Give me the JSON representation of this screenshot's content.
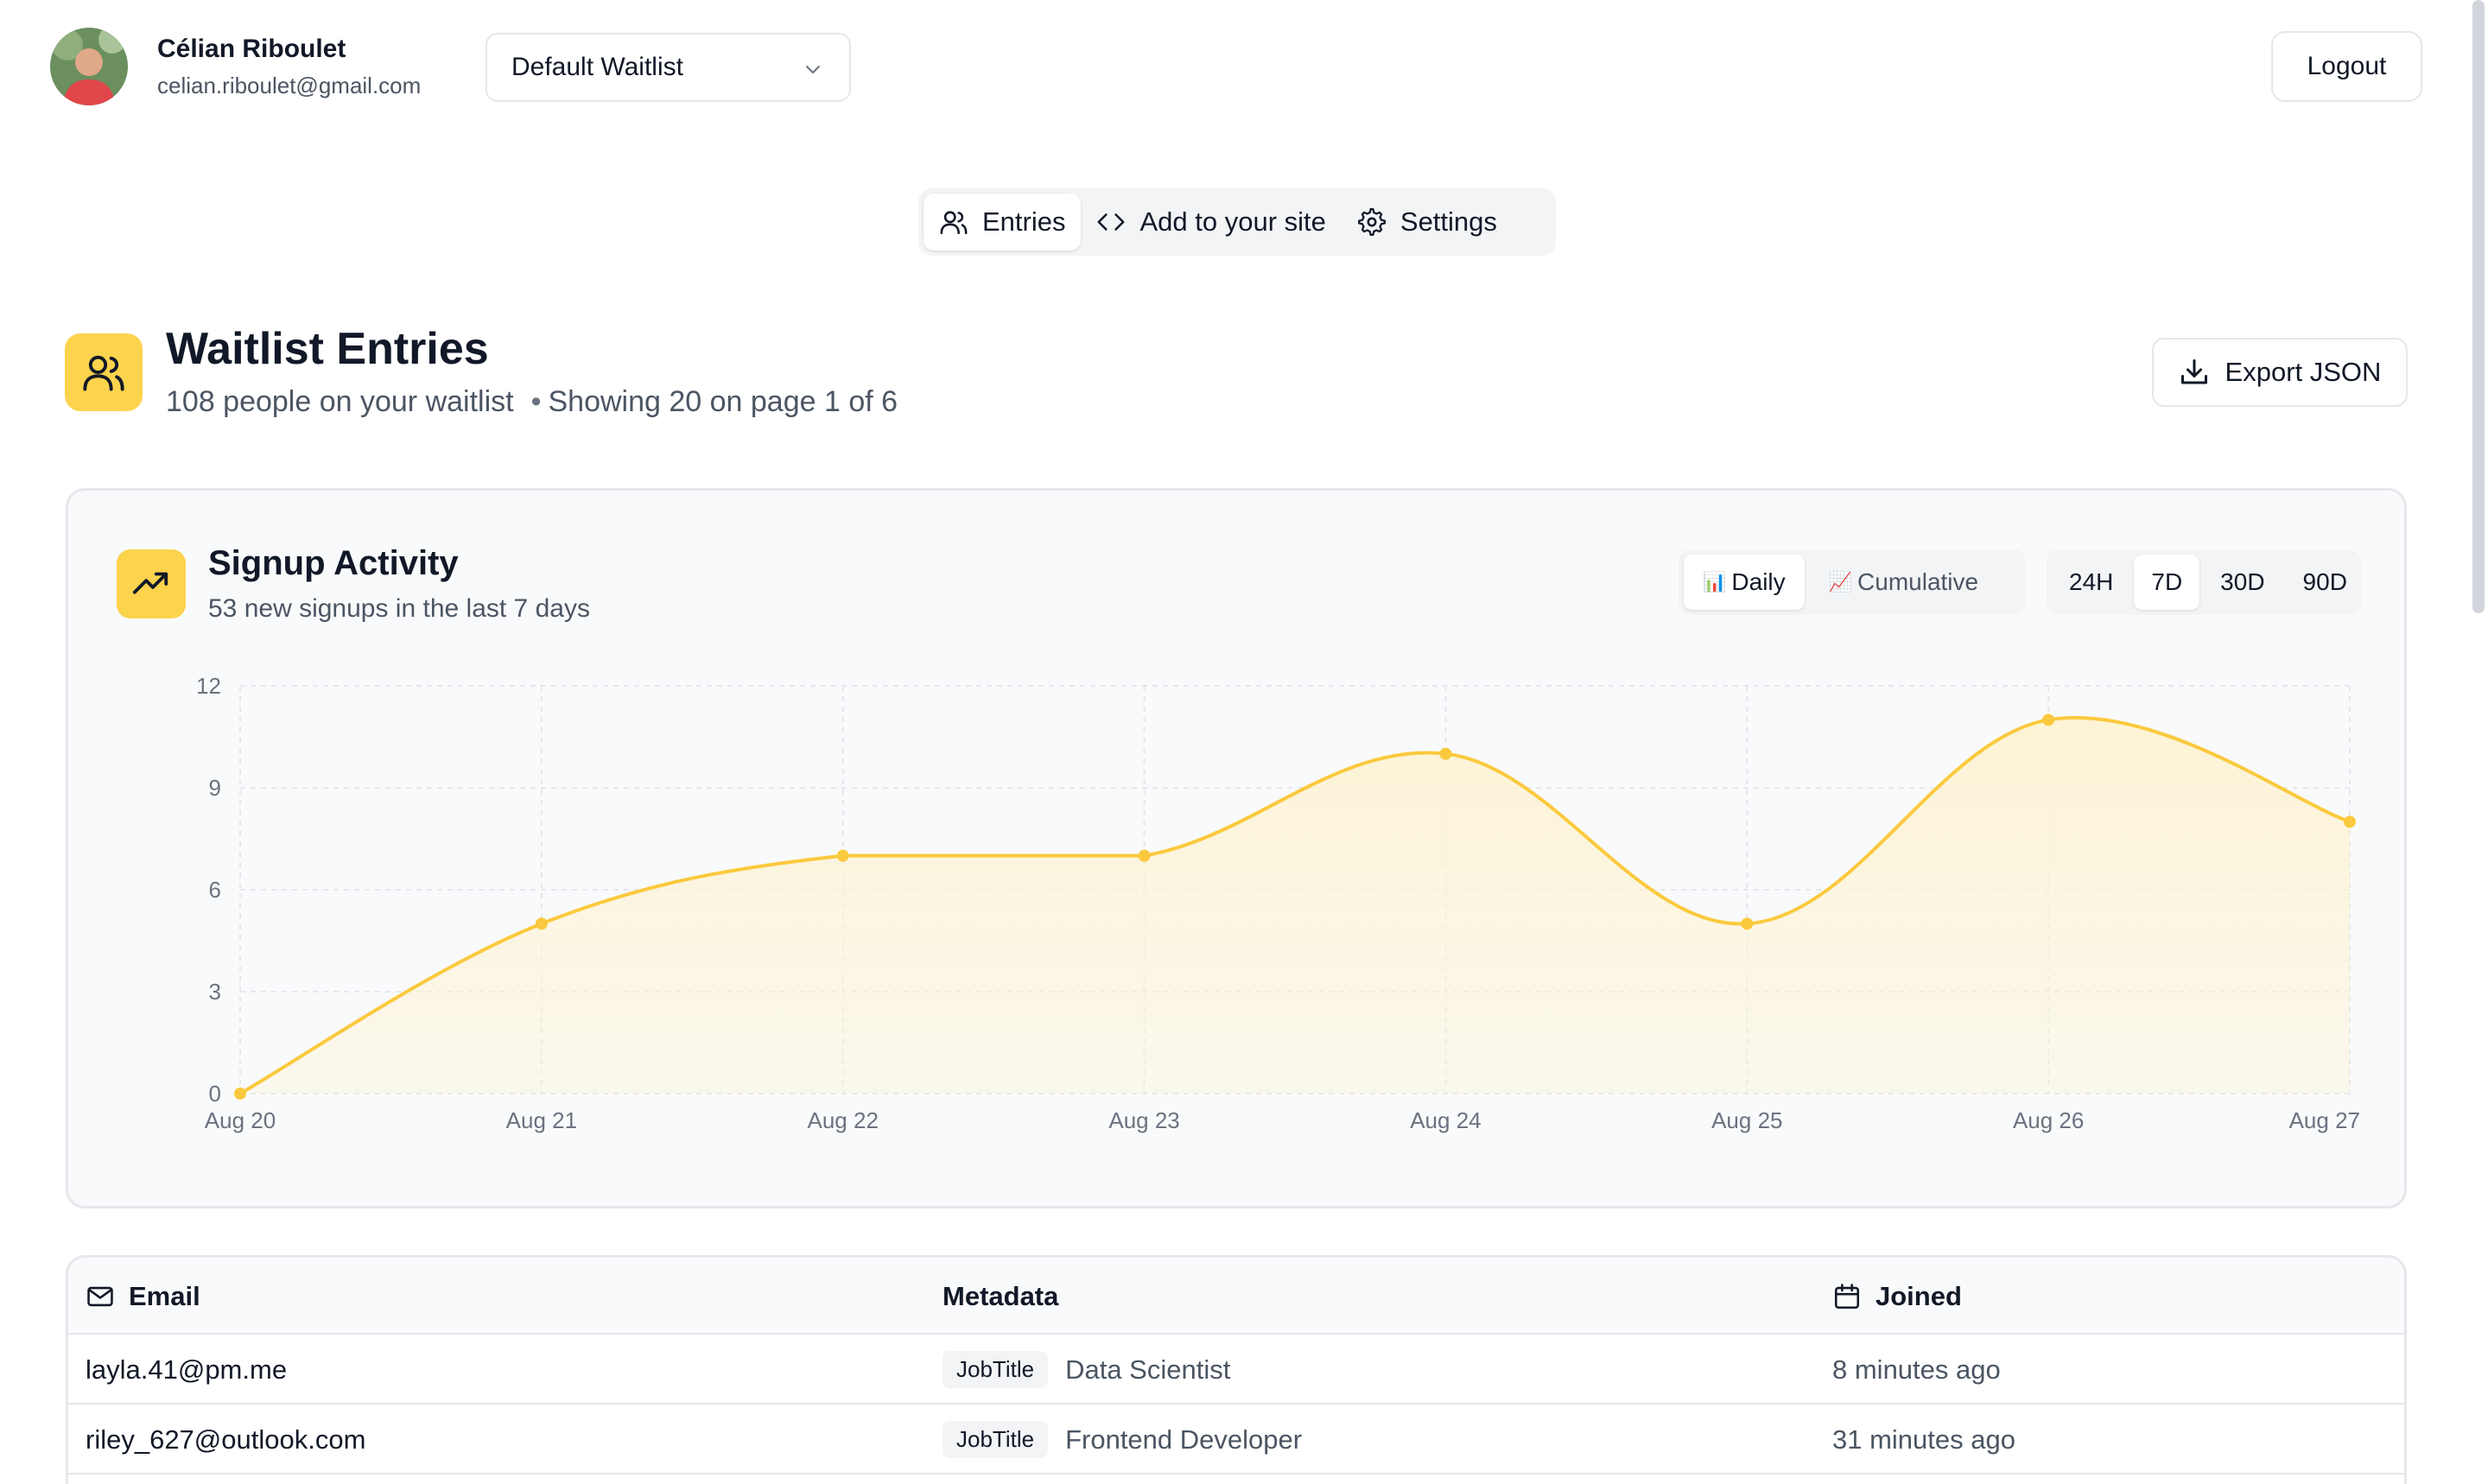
{
  "user": {
    "name": "Célian Riboulet",
    "email": "celian.riboulet@gmail.com"
  },
  "waitlist_select": {
    "value": "Default Waitlist"
  },
  "logout_label": "Logout",
  "tabs": [
    {
      "label": "Entries",
      "icon": "users-icon",
      "active": true
    },
    {
      "label": "Add to your site",
      "icon": "code-icon",
      "active": false
    },
    {
      "label": "Settings",
      "icon": "gear-icon",
      "active": false
    }
  ],
  "page": {
    "title": "Waitlist Entries",
    "count_text": "108 people on your waitlist",
    "separator": "•",
    "paging_text": "Showing 20 on page 1 of 6",
    "export_label": "Export JSON"
  },
  "activity": {
    "title": "Signup Activity",
    "subtitle": "53 new signups in the last 7 days",
    "modes": [
      {
        "label": "Daily",
        "emoji": "📊",
        "active": true
      },
      {
        "label": "Cumulative",
        "emoji": "📈",
        "active": false
      }
    ],
    "ranges": [
      {
        "label": "24H",
        "active": false
      },
      {
        "label": "7D",
        "active": true
      },
      {
        "label": "30D",
        "active": false
      },
      {
        "label": "90D",
        "active": false
      }
    ]
  },
  "colors": {
    "accent": "#fcd34d",
    "line": "#fbc93d",
    "fill": "#fdf3d3"
  },
  "chart_data": {
    "type": "area",
    "categories": [
      "Aug 20",
      "Aug 21",
      "Aug 22",
      "Aug 23",
      "Aug 24",
      "Aug 25",
      "Aug 26",
      "Aug 27"
    ],
    "values": [
      0,
      5,
      7,
      7,
      10,
      5,
      11,
      8
    ],
    "yticks": [
      0,
      3,
      6,
      9,
      12
    ],
    "ylim": [
      0,
      12
    ],
    "grid": true,
    "title": "",
    "xlabel": "",
    "ylabel": ""
  },
  "table": {
    "columns": [
      {
        "label": "Email",
        "icon": "mail-icon"
      },
      {
        "label": "Metadata",
        "icon": ""
      },
      {
        "label": "Joined",
        "icon": "calendar-icon"
      }
    ],
    "rows": [
      {
        "email": "layla.41@pm.me",
        "meta_key": "JobTitle",
        "meta_value": "Data Scientist",
        "joined": "8 minutes ago"
      },
      {
        "email": "riley_627@outlook.com",
        "meta_key": "JobTitle",
        "meta_value": "Frontend Developer",
        "joined": "31 minutes ago"
      }
    ]
  }
}
